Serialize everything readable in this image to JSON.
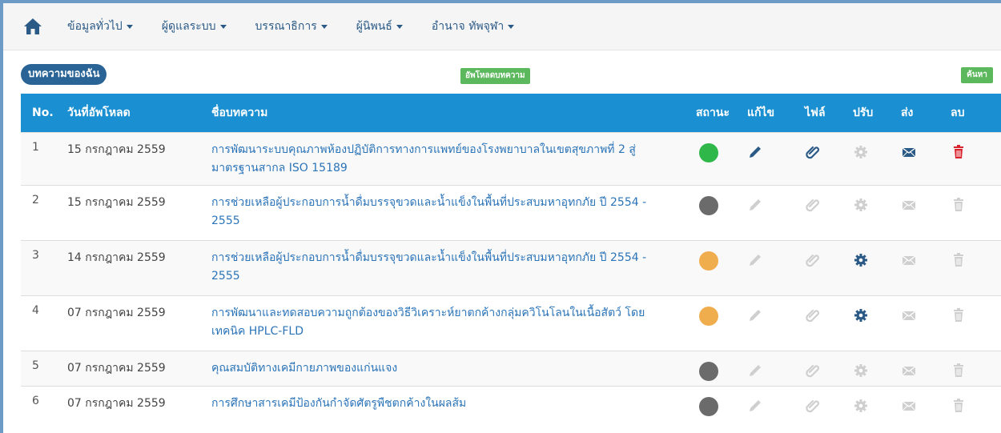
{
  "nav": {
    "home_label": "",
    "items": [
      {
        "label": "ข้อมูลทั่วไป"
      },
      {
        "label": "ผู้ดูแลระบบ"
      },
      {
        "label": "บรรณาธิการ"
      },
      {
        "label": "ผู้นิพนธ์"
      },
      {
        "label": "อำนาจ ทัพจุฬา"
      }
    ]
  },
  "section": {
    "title": "บทความของฉัน",
    "upload_label": "อัพโหลดบทความ",
    "search_label": "ค้นหา"
  },
  "table": {
    "headers": {
      "no": "No.",
      "date": "วันที่อัพโหลด",
      "title": "ชื่อบทความ",
      "status": "สถานะ",
      "edit": "แก้ไข",
      "file": "ไฟล์",
      "adjust": "ปรับ",
      "send": "ส่ง",
      "delete": "ลบ"
    },
    "rows": [
      {
        "no": "1",
        "date": "15 กรกฎาคม 2559",
        "title": "การพัฒนาระบบคุณภาพห้องปฏิบัติการทางการแพทย์ของโรงพยาบาลในเขตสุขภาพที่ 2 สู่มาตรฐานสากล ISO 15189",
        "status_color": "#2fb74a",
        "edit_active": true,
        "file_active": true,
        "adjust_active": false,
        "send_active": true,
        "delete_active": true
      },
      {
        "no": "2",
        "date": "15 กรกฎาคม 2559",
        "title": "การช่วยเหลือผู้ประกอบการน้ำดื่มบรรจุขวดและน้ำแข็งในพื้นที่ประสบมหาอุทกภัย ปี 2554 - 2555",
        "status_color": "#6b6b6b",
        "edit_active": false,
        "file_active": false,
        "adjust_active": false,
        "send_active": false,
        "delete_active": false
      },
      {
        "no": "3",
        "date": "14 กรกฎาคม 2559",
        "title": "การช่วยเหลือผู้ประกอบการน้ำดื่มบรรจุขวดและน้ำแข็งในพื้นที่ประสบมหาอุทกภัย ปี 2554 - 2555",
        "status_color": "#f0ad4e",
        "edit_active": false,
        "file_active": false,
        "adjust_active": true,
        "send_active": false,
        "delete_active": false
      },
      {
        "no": "4",
        "date": "07 กรกฎาคม 2559",
        "title": "การพัฒนาและทดสอบความถูกต้องของวิธีวิเคราะห์ยาตกค้างกลุ่มควิโนโลนในเนื้อสัตว์ โดยเทคนิค HPLC-FLD",
        "status_color": "#f0ad4e",
        "edit_active": false,
        "file_active": false,
        "adjust_active": true,
        "send_active": false,
        "delete_active": false
      },
      {
        "no": "5",
        "date": "07 กรกฎาคม 2559",
        "title": "คุณสมบัติทางเคมีกายภาพของแก่นแจง",
        "status_color": "#6b6b6b",
        "edit_active": false,
        "file_active": false,
        "adjust_active": false,
        "send_active": false,
        "delete_active": false
      },
      {
        "no": "6",
        "date": "07 กรกฎาคม 2559",
        "title": "การศึกษาสารเคมีป้องกันกำจัดศัตรูพืชตกค้างในผลส้ม",
        "status_color": "#6b6b6b",
        "edit_active": false,
        "file_active": false,
        "adjust_active": false,
        "send_active": false,
        "delete_active": false
      }
    ]
  },
  "colors": {
    "header_bg": "#1a8fd1",
    "link": "#2b74b8",
    "pill": "#2a6496",
    "green_button": "#5cb85c",
    "icon_active_blue": "#2b5a87",
    "icon_inactive": "#cfcfcf",
    "delete_active": "#d9232d"
  },
  "icons": {
    "home": "home-icon",
    "edit": "pencil-icon",
    "file": "paperclip-icon",
    "adjust": "gear-icon",
    "send": "envelope-icon",
    "delete": "trash-icon"
  }
}
